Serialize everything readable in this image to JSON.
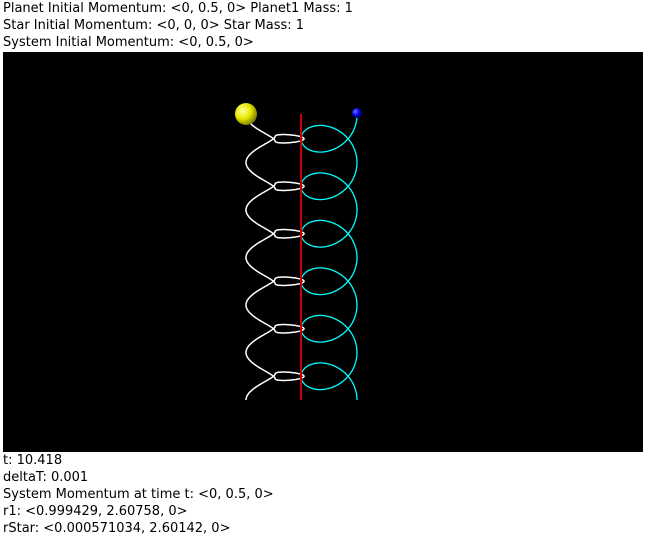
{
  "header": {
    "line1": "Planet Initial Momentum: <0, 0.5, 0> Planet1 Mass: 1",
    "line2": "Star Initial Momentum: <0, 0, 0> Star Mass: 1",
    "line3": "System Initial Momentum: <0, 0.5, 0>"
  },
  "footer": {
    "time": "t: 10.418",
    "deltaT": "deltaT: 0.001",
    "system_momentum": "System Momentum at time t: <0, 0.5, 0>",
    "r1": "r1: <0.999429, 2.60758, 0>",
    "rstar": "rStar: <0.000571034, 2.60142, 0>"
  },
  "scene": {
    "background": "#000000",
    "star_color": "#ffff00",
    "planet_color": "#0000ff",
    "white_trail_color": "#ffffff",
    "cyan_trail_color": "#00ffff",
    "center_line_color": "#ff0000"
  }
}
